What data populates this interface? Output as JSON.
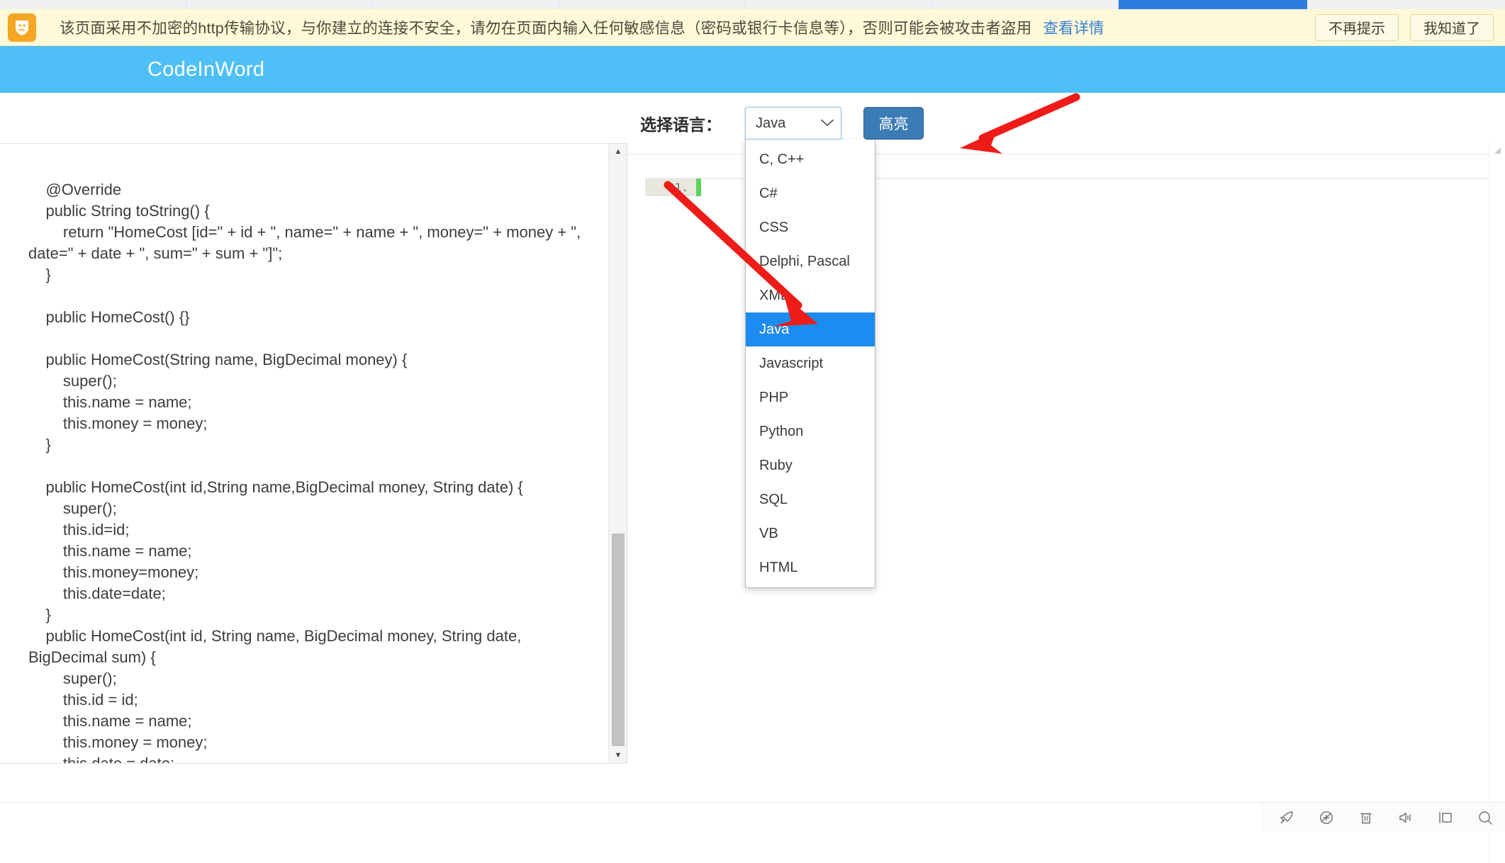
{
  "browser": {
    "tabs": [
      "",
      "",
      "",
      "",
      "",
      "",
      ""
    ],
    "active_tab_index": 6
  },
  "warning_bar": {
    "icon": "sad-face-shield-icon",
    "message": "该页面采用不加密的http传输协议，与你建立的连接不安全，请勿在页面内输入任何敏感信息（密码或银行卡信息等），否则可能会被攻击者盗用",
    "details_link": "查看详情",
    "dismiss_button": "不再提示",
    "ack_button": "我知道了",
    "background_color": "#fdf9d9",
    "icon_color": "#f5a623",
    "link_color": "#3b7fd4"
  },
  "site_header": {
    "brand": "CodeInWord",
    "background_color": "#4fc0f7"
  },
  "code_panel": {
    "code": "    @Override\n    public String toString() {\n        return \"HomeCost [id=\" + id + \", name=\" + name + \", money=\" + money + \", date=\" + date + \", sum=\" + sum + \"]\";\n    }\n\n    public HomeCost() {}\n\n    public HomeCost(String name, BigDecimal money) {\n        super();\n        this.name = name;\n        this.money = money;\n    }\n\n    public HomeCost(int id,String name,BigDecimal money, String date) {\n        super();\n        this.id=id;\n        this.name = name;\n        this.money=money;\n        this.date=date;\n    }\n    public HomeCost(int id, String name, BigDecimal money, String date, BigDecimal sum) {\n        super();\n        this.id = id;\n        this.name = name;\n        this.money = money;\n        this.date = date;\n        this.sum = sum;\n    }",
    "scroll_up_arrow": "▲",
    "scroll_down_arrow": "▼"
  },
  "toolbar": {
    "language_label": "选择语言：",
    "highlight_button": "高亮",
    "highlight_button_color": "#3b7cb5"
  },
  "language_select": {
    "selected_value": "Java",
    "chevron_icon": "chevron-down-icon",
    "options": [
      "C, C++",
      "C#",
      "CSS",
      "Delphi, Pascal",
      "XML",
      "Java",
      "Javascript",
      "PHP",
      "Python",
      "Ruby",
      "SQL",
      "VB",
      "HTML"
    ],
    "selected_index": 5,
    "highlight_color": "#1d8cf0"
  },
  "editor": {
    "line_number": "01.",
    "line_content": "",
    "caret_color": "#5dd35d",
    "gutter_color": "#e8e8e0"
  },
  "page_scroll": {
    "up_arrow": "◢"
  },
  "system_bar": {
    "icons": [
      "rocket-icon",
      "add-circle-icon",
      "trash-icon",
      "volume-icon",
      "sidebar-icon",
      "search-icon"
    ]
  },
  "annotations": {
    "arrow_to_highlight_button": "red-arrow-pointing-to-highlight-button",
    "arrow_to_java_option": "red-arrow-pointing-to-java-option",
    "arrow_color": "#ee1c18"
  }
}
